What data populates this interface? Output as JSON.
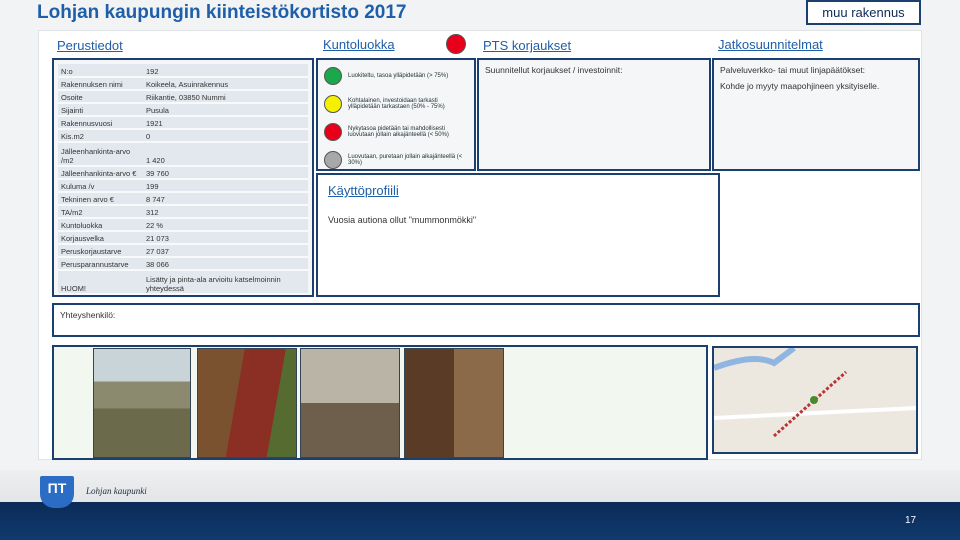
{
  "title": "Lohjan kaupungin kiinteistökortisto 2017",
  "building_type": "muu rakennus",
  "perustiedot": {
    "heading": "Perustiedot",
    "rows": [
      [
        "N:o",
        "192"
      ],
      [
        "Rakennuksen nimi",
        "Koikeela, Asuinrakennus"
      ],
      [
        "Osoite",
        "Riikantie, 03850 Nummi"
      ],
      [
        "Sijainti",
        "Pusula"
      ],
      [
        "Rakennusvuosi",
        "1921"
      ],
      [
        "Kis.m2",
        "0"
      ],
      [
        "Jälleenhankinta-arvo /m2",
        "1 420"
      ],
      [
        "Jälleenhankinta-arvo €",
        "39 760"
      ],
      [
        "Kuluma /v",
        "199"
      ],
      [
        "Tekninen arvo €",
        "8 747"
      ],
      [
        "TA/m2",
        "312"
      ],
      [
        "Kuntoluokka",
        "22 %"
      ],
      [
        "Korjausvelka",
        "21 073"
      ],
      [
        "Peruskorjaustarve",
        "27 037"
      ],
      [
        "Perusparannustarve",
        "38 066"
      ],
      [
        "HUOM!",
        "Lisätty ja pinta-ala arvioitu katselmoinnin yhteydessä"
      ]
    ]
  },
  "kuntoluokka": {
    "heading": "Kuntoluokka",
    "status_color": "#e8001a",
    "legend": [
      {
        "color": "#1aa84a",
        "text": "Luokiteltu, tasoa ylläpidetään (> 75%)"
      },
      {
        "color": "#f4f000",
        "text": "Kohtalainen, investoidaan tarkasti ylläpidetään tarkastaen (50% - 75%)"
      },
      {
        "color": "#e8001a",
        "text": "Nykytasoa pidetään tai mahdollisesti luovutaan jollain aikajänteellä (< 50%)"
      },
      {
        "color": "#a8a8a8",
        "text": "Luovutaan, puretaan jollain aikajänteellä (< 30%)"
      }
    ]
  },
  "pts": {
    "heading": "PTS korjaukset",
    "text": "Suunnitellut korjaukset / investoinnit:"
  },
  "jatko": {
    "heading": "Jatkosuunnitelmat",
    "line1": "Palveluverkko- tai muut linjapäätökset:",
    "line2": "Kohde jo myyty maapohjineen yksityiselle."
  },
  "kaytto": {
    "heading": "Käyttöprofiili",
    "text": "Vuosia autiona ollut \"mummonmökki\""
  },
  "contact": {
    "label": "Yhteyshenkilö:"
  },
  "footer": {
    "org": "Lohjan kaupunki",
    "page": "17"
  }
}
